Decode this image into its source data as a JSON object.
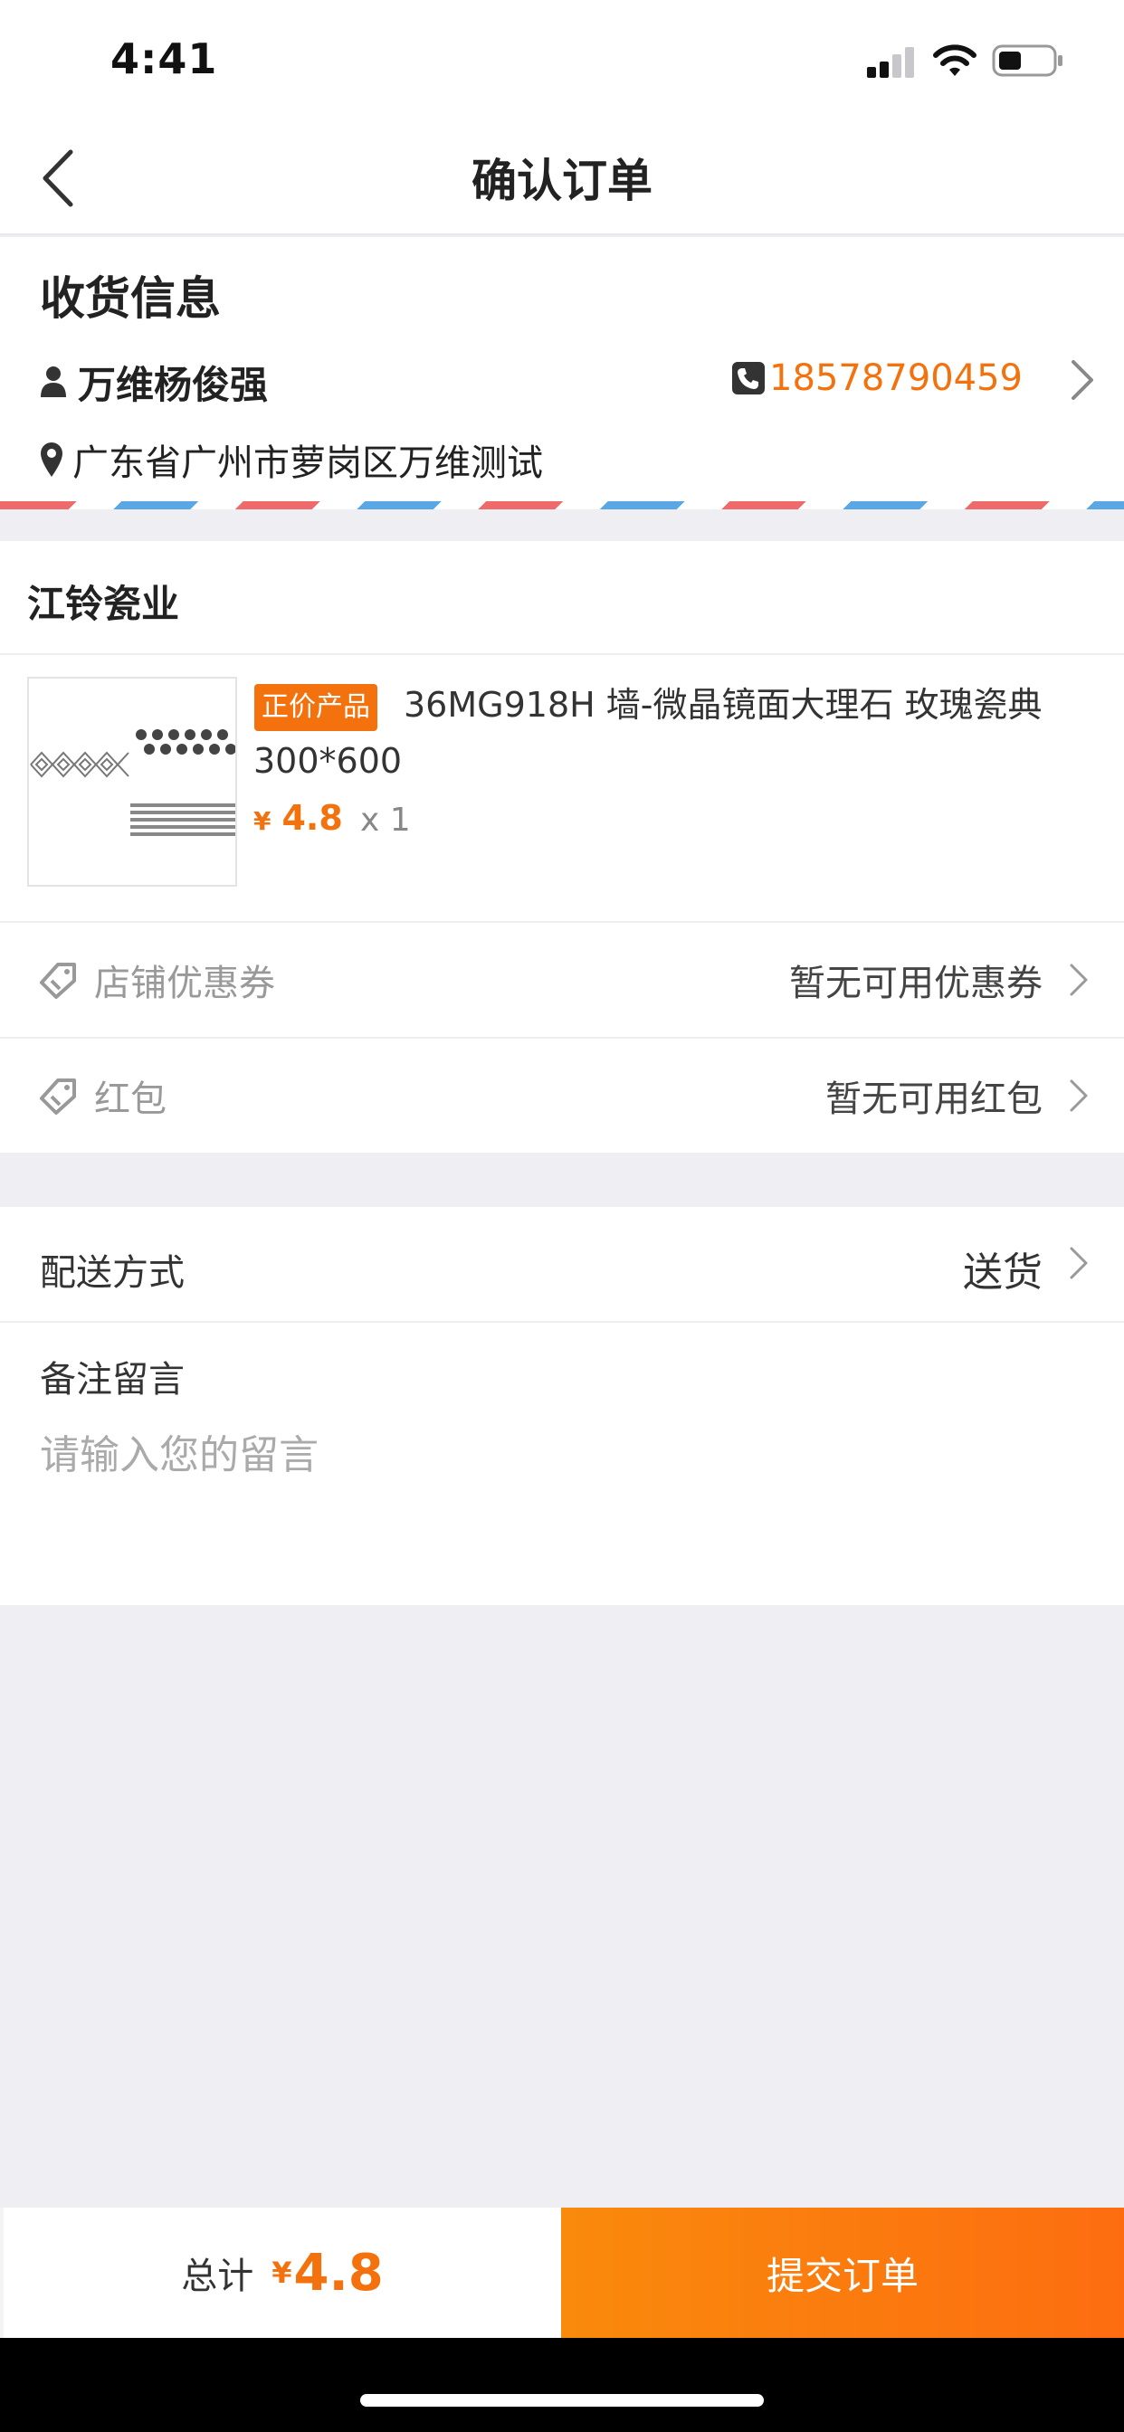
{
  "status_bar": {
    "time": "4:41"
  },
  "nav": {
    "title": "确认订单",
    "back_icon": "chevron-left-icon"
  },
  "address": {
    "heading": "收货信息",
    "name": "万维杨俊强",
    "phone": "18578790459",
    "location": "广东省广州市萝岗区万维测试",
    "icons": [
      "user-icon",
      "phone-icon",
      "location-pin-icon",
      "chevron-right-icon"
    ]
  },
  "store": {
    "name": "江铃瓷业",
    "product": {
      "tag": "正价产品",
      "title": "36MG918H 墙-微晶镜面大理石 玫瑰瓷典300*600",
      "currency": "¥",
      "price": "4.8",
      "quantity": "x 1"
    },
    "coupon": {
      "label": "店铺优惠券",
      "value": "暂无可用优惠券",
      "icon": "coupon-tag-icon"
    },
    "red_packet": {
      "label": "红包",
      "value": "暂无可用红包",
      "icon": "coupon-tag-icon"
    }
  },
  "delivery": {
    "label": "配送方式",
    "value": "送货",
    "note_label": "备注留言",
    "note_placeholder": "请输入您的留言"
  },
  "footer": {
    "total_label": "总计",
    "currency": "¥",
    "total": "4.8",
    "submit_label": "提交订单"
  },
  "colors": {
    "accent": "#f4720d",
    "background": "#efeff3",
    "stripe_red": "#ef6b6b",
    "stripe_blue": "#5aa7e6"
  }
}
